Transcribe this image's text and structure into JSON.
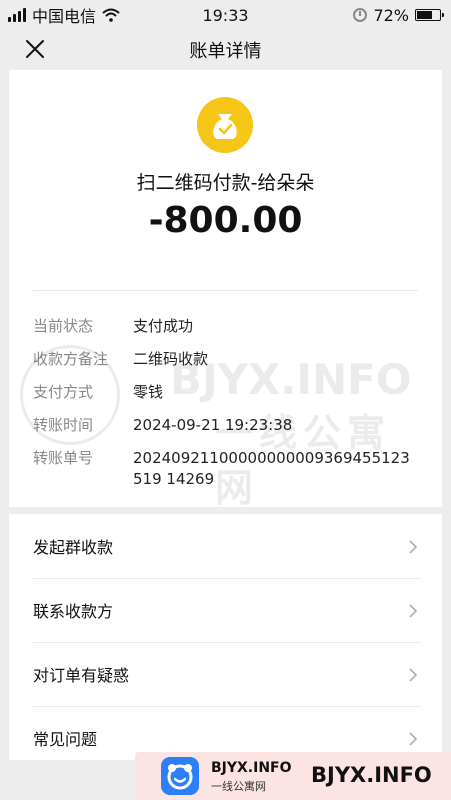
{
  "status_bar": {
    "carrier": "中国电信",
    "time": "19:33",
    "battery_text": "72%",
    "battery_level": 0.72
  },
  "nav": {
    "title": "账单详情",
    "close_icon": "close-icon"
  },
  "summary": {
    "icon": "money-bag-icon",
    "icon_color": "#F5C518",
    "payee": "扫二维码付款-给朵朵",
    "amount": "-800.00"
  },
  "details": [
    {
      "label": "当前状态",
      "value": "支付成功"
    },
    {
      "label": "收款方备注",
      "value": "二维码收款"
    },
    {
      "label": "支付方式",
      "value": "零钱"
    },
    {
      "label": "转账时间",
      "value": "2024-09-21 19:23:38"
    },
    {
      "label": "转账单号",
      "value": "20240921100000000009369455123519 14269"
    }
  ],
  "menu": [
    {
      "label": "发起群收款"
    },
    {
      "label": "联系收款方"
    },
    {
      "label": "对订单有疑惑"
    },
    {
      "label": "常见问题"
    }
  ],
  "watermark": {
    "line1": "BJYX.INFO",
    "line2": "一线公寓网"
  },
  "banner": {
    "site": "BJYX.INFO",
    "sub": "一线公寓网",
    "big": "BJYX.INFO",
    "logo_color": "#2D7FF9"
  }
}
